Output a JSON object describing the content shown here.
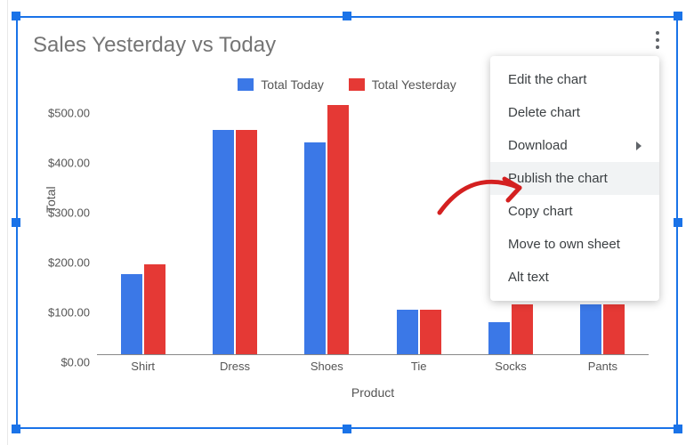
{
  "title": "Sales Yesterday vs Today",
  "legend": {
    "today": "Total Today",
    "yesterday": "Total Yesterday"
  },
  "axes": {
    "ylabel": "Total",
    "xlabel": "Product",
    "y_ticks": [
      "$0.00",
      "$100.00",
      "$200.00",
      "$300.00",
      "$400.00",
      "$500.00"
    ]
  },
  "colors": {
    "today": "#3b78e7",
    "yesterday": "#e53935",
    "select": "#1a73e8"
  },
  "menu": {
    "items": [
      {
        "label": "Edit the chart",
        "submenu": false,
        "highlight": false
      },
      {
        "label": "Delete chart",
        "submenu": false,
        "highlight": false
      },
      {
        "label": "Download",
        "submenu": true,
        "highlight": false
      },
      {
        "label": "Publish the chart",
        "submenu": false,
        "highlight": true
      },
      {
        "label": "Copy chart",
        "submenu": false,
        "highlight": false
      },
      {
        "label": "Move to own sheet",
        "submenu": false,
        "highlight": false
      },
      {
        "label": "Alt text",
        "submenu": false,
        "highlight": false
      }
    ]
  },
  "chart_data": {
    "type": "bar",
    "title": "Sales Yesterday vs Today",
    "xlabel": "Product",
    "ylabel": "Total",
    "ylim": [
      0,
      500
    ],
    "categories": [
      "Shirt",
      "Dress",
      "Shoes",
      "Tie",
      "Socks",
      "Pants"
    ],
    "series": [
      {
        "name": "Total Today",
        "color": "#3b78e7",
        "values": [
          160,
          450,
          425,
          90,
          65,
          100
        ]
      },
      {
        "name": "Total Yesterday",
        "color": "#e53935",
        "values": [
          180,
          450,
          500,
          90,
          100,
          100
        ]
      }
    ]
  }
}
